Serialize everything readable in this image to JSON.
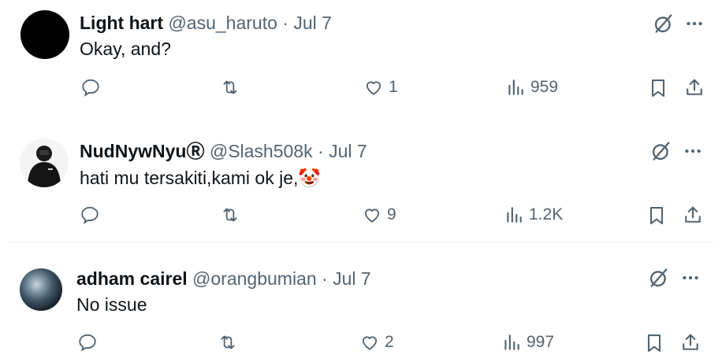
{
  "tweets": [
    {
      "display_name": "Light hart",
      "handle": "@asu_haruto",
      "separator": "·",
      "date": "Jul 7",
      "text": "Okay, and?",
      "emoji": "",
      "likes": "1",
      "views": "959"
    },
    {
      "display_name": "NudNywNyu",
      "name_badge": "Ⓡ",
      "handle": "@Slash508k",
      "separator": "·",
      "date": "Jul 7",
      "text": "hati mu tersakiti,kami ok je,",
      "emoji": "🤡",
      "likes": "9",
      "views": "1.2K"
    },
    {
      "display_name": "adham cairel",
      "handle": "@orangbumian",
      "separator": "·",
      "date": "Jul 7",
      "text": "No issue",
      "emoji": "",
      "likes": "2",
      "views": "997"
    }
  ],
  "icons": {
    "reply": "reply-icon",
    "retweet": "retweet-icon",
    "like": "heart-icon",
    "views": "views-icon",
    "bookmark": "bookmark-icon",
    "share": "share-icon",
    "grok": "grok-icon",
    "more": "more-icon"
  },
  "colors": {
    "text": "#0f1419",
    "muted": "#536471",
    "divider": "#eff3f4"
  }
}
